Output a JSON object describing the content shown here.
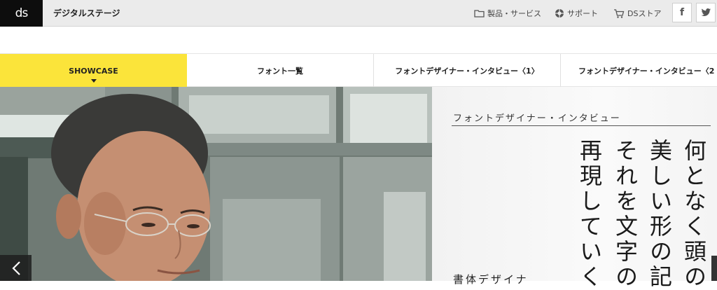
{
  "header": {
    "logo_text": "ds",
    "site_title": "デジタルステージ",
    "links": [
      {
        "label": "製品・サービス",
        "icon": "folder-icon"
      },
      {
        "label": "サポート",
        "icon": "lifebuoy-icon"
      },
      {
        "label": "DSストア",
        "icon": "cart-icon"
      }
    ],
    "social": [
      {
        "label": "f",
        "icon": "facebook-icon"
      },
      {
        "label": "twitter",
        "icon": "twitter-icon"
      }
    ]
  },
  "nav": {
    "items": [
      {
        "label": "SHOWCASE",
        "active": true
      },
      {
        "label": "フォント一覧",
        "active": false
      },
      {
        "label": "フォントデザイナー・インタビュー〈1〉",
        "active": false
      },
      {
        "label": "フォントデザイナー・インタビュー〈2",
        "active": false
      }
    ]
  },
  "hero": {
    "kicker": "フォントデザイナー・インタビュー",
    "headline_columns": [
      "何となく頭の",
      "美しい形の記",
      "それを文字の",
      "再現していく"
    ],
    "caption": "書体デザイナ",
    "colors": {
      "accent": "#fbe43a",
      "dark": "#0d0d0d"
    }
  }
}
